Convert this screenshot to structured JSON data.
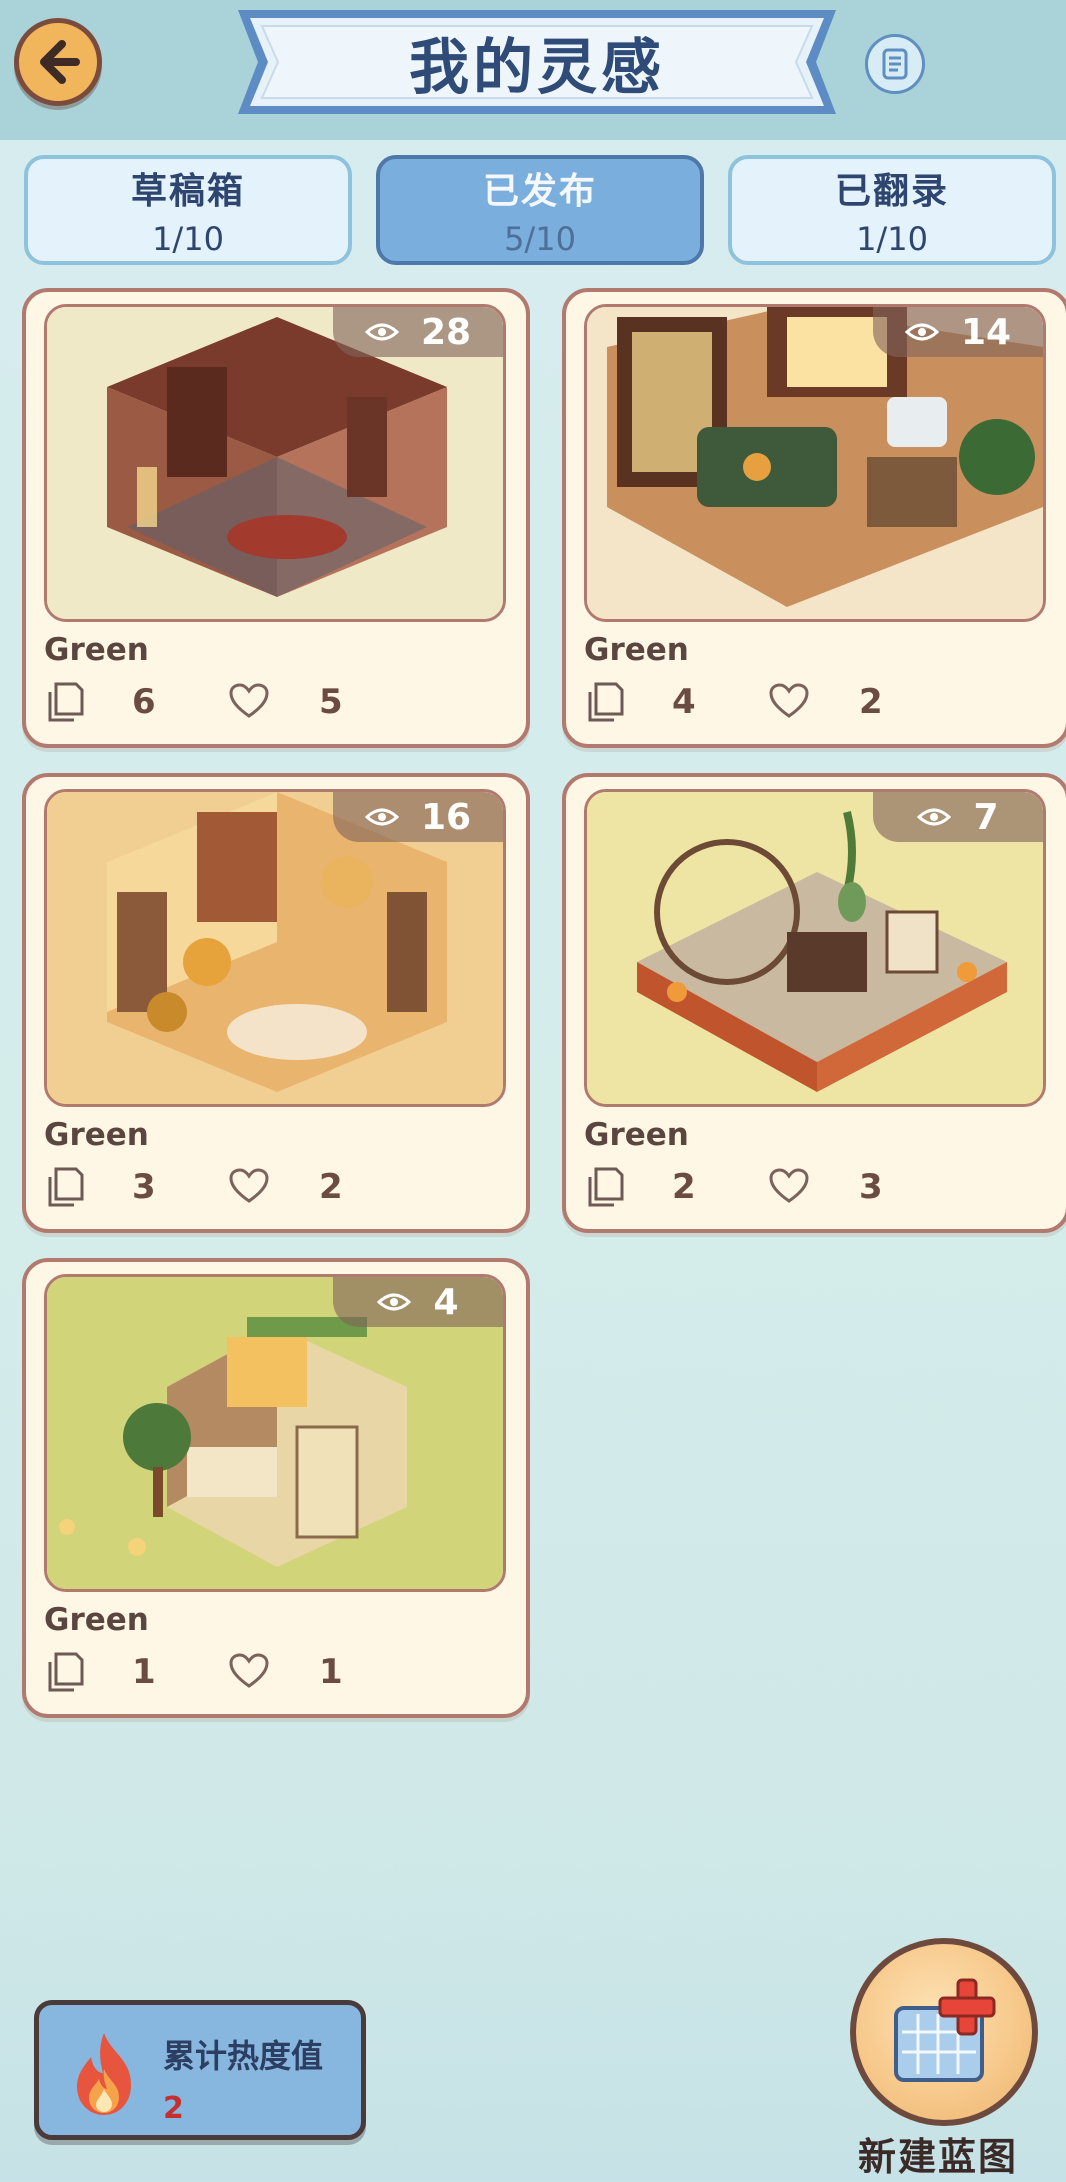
{
  "header": {
    "title": "我的灵感",
    "back_icon": "back-arrow-icon",
    "notes_icon": "scroll-list-icon"
  },
  "tabs": [
    {
      "label": "草稿箱",
      "count": "1/10",
      "active": false
    },
    {
      "label": "已发布",
      "count": "5/10",
      "active": true
    },
    {
      "label": "已翻录",
      "count": "1/10",
      "active": false
    }
  ],
  "cards": [
    {
      "name": "Green",
      "views": "28",
      "copies": "6",
      "likes": "5",
      "scene": "study-room"
    },
    {
      "name": "Green",
      "views": "14",
      "copies": "4",
      "likes": "2",
      "scene": "living-room"
    },
    {
      "name": "Green",
      "views": "16",
      "copies": "3",
      "likes": "2",
      "scene": "warm-dining-room"
    },
    {
      "name": "Green",
      "views": "7",
      "copies": "2",
      "likes": "3",
      "scene": "garden-patio"
    },
    {
      "name": "Green",
      "views": "4",
      "copies": "1",
      "likes": "1",
      "scene": "plant-office"
    }
  ],
  "heat": {
    "label": "累计热度值",
    "value": "2"
  },
  "new_blueprint": {
    "label": "新建蓝图"
  },
  "colors": {
    "accent_blue": "#7aaedc",
    "card_border": "#b27a6f",
    "card_bg": "#fff7e6",
    "title_text": "#2f4b78",
    "heat_value": "#c4302f"
  }
}
